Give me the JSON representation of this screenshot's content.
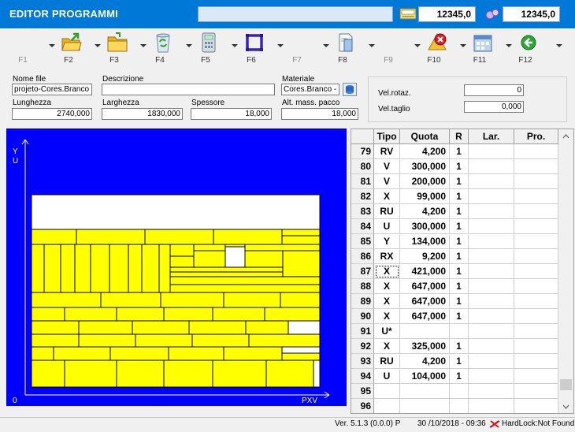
{
  "window": {
    "title": "EDITOR PROGRAMMI",
    "counter1": "12345,0",
    "counter2": "12345,0"
  },
  "toolbar": {
    "keys": [
      {
        "label": "F1",
        "icon": "none",
        "enabled": false
      },
      {
        "label": "F2",
        "icon": "open-folder-icon",
        "enabled": true
      },
      {
        "label": "F3",
        "icon": "folder-icon",
        "enabled": true
      },
      {
        "label": "F4",
        "icon": "recycle-bin-icon",
        "enabled": true
      },
      {
        "label": "F5",
        "icon": "calculator-icon",
        "enabled": true
      },
      {
        "label": "F6",
        "icon": "panel-frame-icon",
        "enabled": true
      },
      {
        "label": "F7",
        "icon": "none",
        "enabled": false
      },
      {
        "label": "F8",
        "icon": "document-edit-icon",
        "enabled": true
      },
      {
        "label": "F9",
        "icon": "none",
        "enabled": false
      },
      {
        "label": "F10",
        "icon": "error-delete-icon",
        "enabled": true
      },
      {
        "label": "F11",
        "icon": "calendar-grid-icon",
        "enabled": true
      },
      {
        "label": "F12",
        "icon": "back-arrow-icon",
        "enabled": true
      }
    ]
  },
  "params": {
    "nome_file_label": "Nome file",
    "nome_file": "projeto-Cores.Branco -",
    "descrizione_label": "Descrizione",
    "descrizione": "",
    "materiale_label": "Materiale",
    "materiale": "Cores.Branco - M",
    "lunghezza_label": "Lunghezza",
    "lunghezza": "2740,000",
    "larghezza_label": "Larghezza",
    "larghezza": "1830,000",
    "spessore_label": "Spessore",
    "spessore": "18,000",
    "alt_label": "Alt. mass. pacco",
    "alt": "18,000",
    "vel_rotaz_label": "Vel.rotaz.",
    "vel_rotaz": "0",
    "vel_taglio_label": "Vel.taglio",
    "vel_taglio": "0,000"
  },
  "canvas": {
    "background": "#0000ff",
    "panel_color": "#ffff00",
    "waste_color": "#ffffff",
    "axis_y_label": "Y",
    "axis_u_label": "U",
    "axis_x_label": "PXV",
    "origin_label": "0"
  },
  "grid": {
    "columns": [
      "Tipo",
      "Quota",
      "R",
      "Lar.",
      "Pro."
    ],
    "rows": [
      {
        "n": "79",
        "tipo": "RV",
        "quota": "4,200",
        "r": "1"
      },
      {
        "n": "80",
        "tipo": "V",
        "quota": "300,000",
        "r": "1"
      },
      {
        "n": "81",
        "tipo": "V",
        "quota": "200,000",
        "r": "1"
      },
      {
        "n": "82",
        "tipo": "X",
        "quota": "99,000",
        "r": "1"
      },
      {
        "n": "83",
        "tipo": "RU",
        "quota": "4,200",
        "r": "1"
      },
      {
        "n": "84",
        "tipo": "U",
        "quota": "300,000",
        "r": "1"
      },
      {
        "n": "85",
        "tipo": "Y",
        "quota": "134,000",
        "r": "1"
      },
      {
        "n": "86",
        "tipo": "RX",
        "quota": "9,200",
        "r": "1"
      },
      {
        "n": "87",
        "tipo": "X",
        "quota": "421,000",
        "r": "1"
      },
      {
        "n": "88",
        "tipo": "X",
        "quota": "647,000",
        "r": "1"
      },
      {
        "n": "89",
        "tipo": "X",
        "quota": "647,000",
        "r": "1"
      },
      {
        "n": "90",
        "tipo": "X",
        "quota": "647,000",
        "r": "1"
      },
      {
        "n": "91",
        "tipo": "U*",
        "quota": "",
        "r": ""
      },
      {
        "n": "92",
        "tipo": "X",
        "quota": "325,000",
        "r": "1"
      },
      {
        "n": "93",
        "tipo": "RU",
        "quota": "4,200",
        "r": "1"
      },
      {
        "n": "94",
        "tipo": "U",
        "quota": "104,000",
        "r": "1"
      },
      {
        "n": "95",
        "tipo": "",
        "quota": "",
        "r": ""
      },
      {
        "n": "96",
        "tipo": "",
        "quota": "",
        "r": ""
      }
    ]
  },
  "status": {
    "version": "Ver. 5.1.3 (0.0.0) P",
    "datetime": "30 /10/2018 - 09:36",
    "hardlock": "HardLock:Not Found"
  }
}
